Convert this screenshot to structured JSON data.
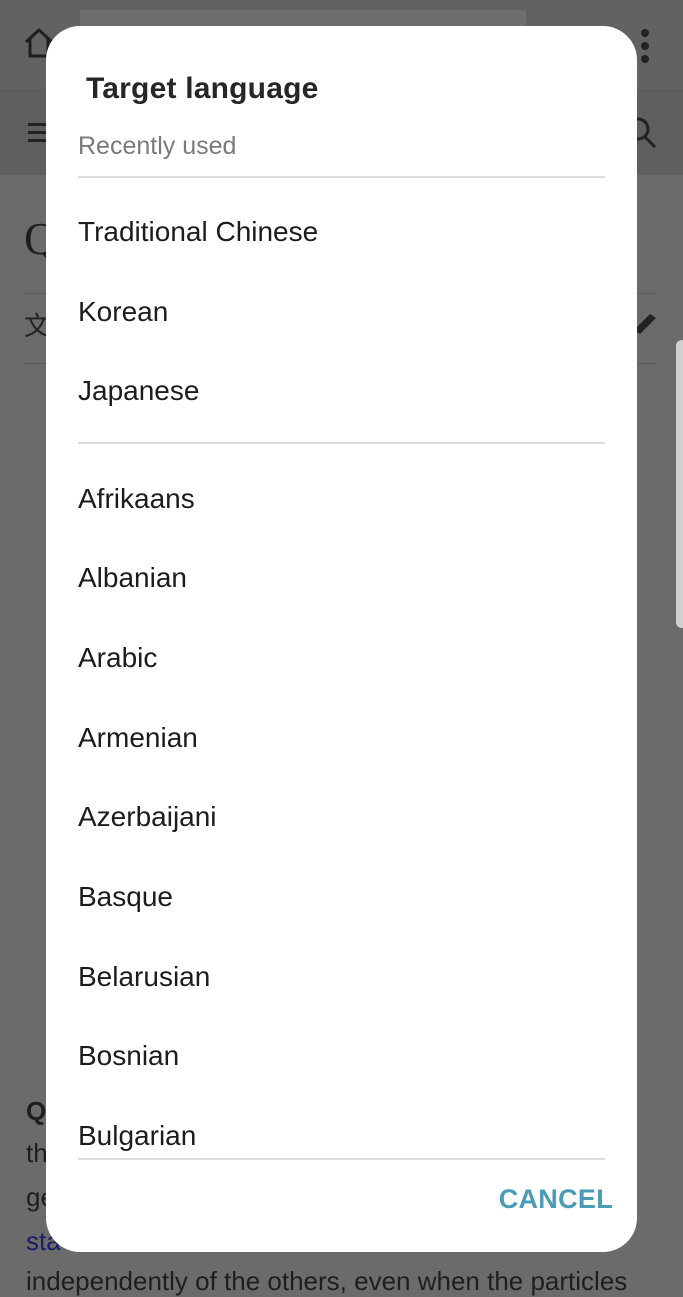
{
  "background_page": {
    "title_glyph": "Q",
    "paragraph_lines": [
      {
        "text": "Q",
        "style": "bold"
      },
      {
        "text": "th",
        "style": "normal"
      },
      {
        "text": "ge",
        "style": "normal"
      },
      {
        "text": "sta",
        "style": "link"
      },
      {
        "text": "independently of the others, even when the particles",
        "style": "normal"
      }
    ],
    "translate_glyph": "文"
  },
  "dialog": {
    "title": "Target language",
    "recent_label": "Recently used",
    "recent_languages": [
      "Traditional Chinese",
      "Korean",
      "Japanese"
    ],
    "all_languages": [
      "Afrikaans",
      "Albanian",
      "Arabic",
      "Armenian",
      "Azerbaijani",
      "Basque",
      "Belarusian",
      "Bosnian",
      "Bulgarian"
    ],
    "cancel_label": "CANCEL"
  },
  "colors": {
    "accent": "#4a9bb5",
    "scrim": "#6b6b6b"
  }
}
